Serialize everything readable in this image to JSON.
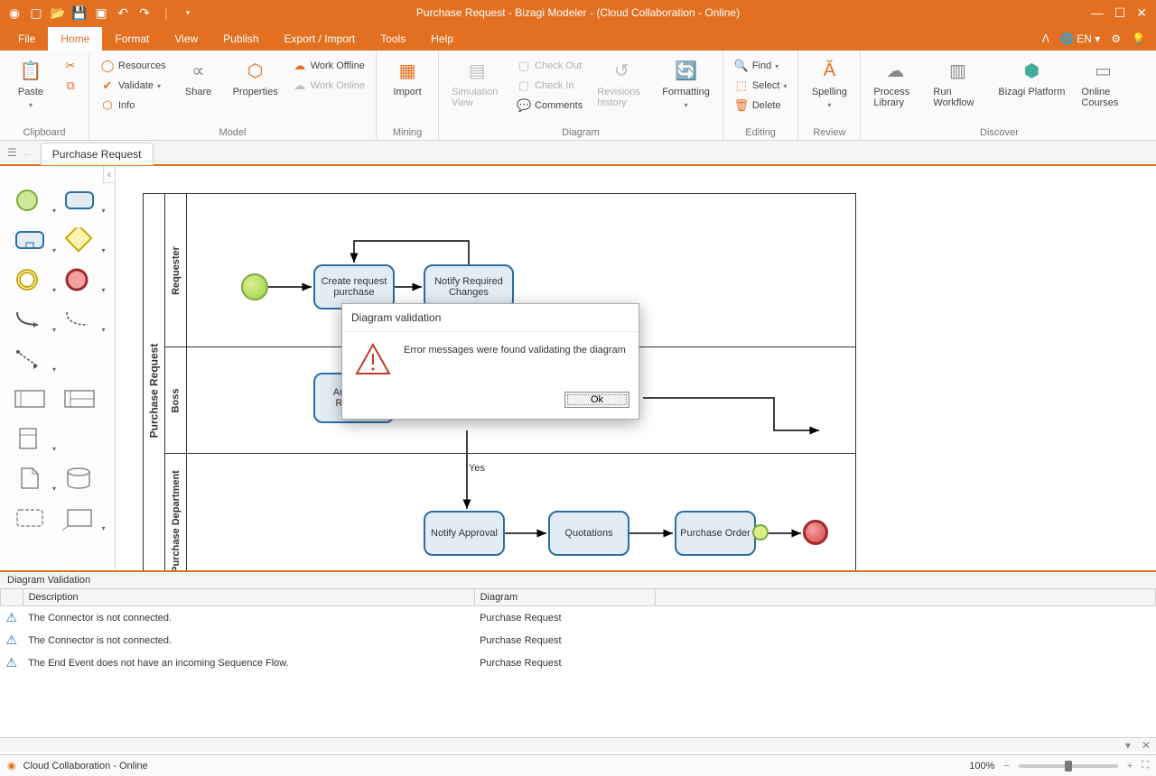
{
  "app": {
    "title": "Purchase Request - Bizagi Modeler - (Cloud Collaboration - Online)"
  },
  "menutabs": {
    "file": "File",
    "home": "Home",
    "format": "Format",
    "view": "View",
    "publish": "Publish",
    "exportimport": "Export / Import",
    "tools": "Tools",
    "help": "Help"
  },
  "menuright": {
    "lang": "EN"
  },
  "ribbon": {
    "clipboard": {
      "paste": "Paste",
      "label": "Clipboard"
    },
    "model": {
      "label": "Model",
      "resources": "Resources",
      "validate": "Validate",
      "info": "Info",
      "share": "Share",
      "properties": "Properties",
      "workoffline": "Work Offline",
      "workonline": "Work Online"
    },
    "mining": {
      "label": "Mining",
      "import": "Import"
    },
    "diagram": {
      "label": "Diagram",
      "simview": "Simulation View",
      "checkout": "Check Out",
      "checkin": "Check In",
      "comments": "Comments",
      "revhist": "Revisions history",
      "formatting": "Formatting"
    },
    "editing": {
      "label": "Editing",
      "find": "Find",
      "select": "Select",
      "delete": "Delete"
    },
    "review": {
      "label": "Review",
      "spelling": "Spelling"
    },
    "discover": {
      "label": "Discover",
      "plib": "Process Library",
      "workflow": "Run Workflow",
      "platform": "Bizagi Platform",
      "courses": "Online Courses"
    }
  },
  "doctab": {
    "name": "Purchase Request"
  },
  "diagram": {
    "pool": "Purchase Request",
    "lanes": {
      "l1": "Requester",
      "l2": "Boss",
      "l3": "Purchase Department"
    },
    "tasks": {
      "t1": "Create request purchase",
      "t2": "Notify Required Changes",
      "t3": "Authorize Request",
      "t4": "Notify Approval",
      "t5": "Quotations",
      "t6": "Purchase Order"
    },
    "labels": {
      "yes": "Yes"
    }
  },
  "dialog": {
    "title": "Diagram validation",
    "msg": "Error messages were found validating the diagram",
    "ok": "Ok"
  },
  "validation": {
    "panel_title": "Diagram Validation",
    "col_desc": "Description",
    "col_diag": "Diagram",
    "rows": {
      "r1d": "The Connector is not connected.",
      "r1g": "Purchase Request",
      "r2d": "The Connector is not connected.",
      "r2g": "Purchase Request",
      "r3d": "The End Event does not have an incoming Sequence Flow.",
      "r3g": "Purchase Request"
    }
  },
  "status": {
    "text": "Cloud Collaboration - Online",
    "zoom": "100%"
  }
}
